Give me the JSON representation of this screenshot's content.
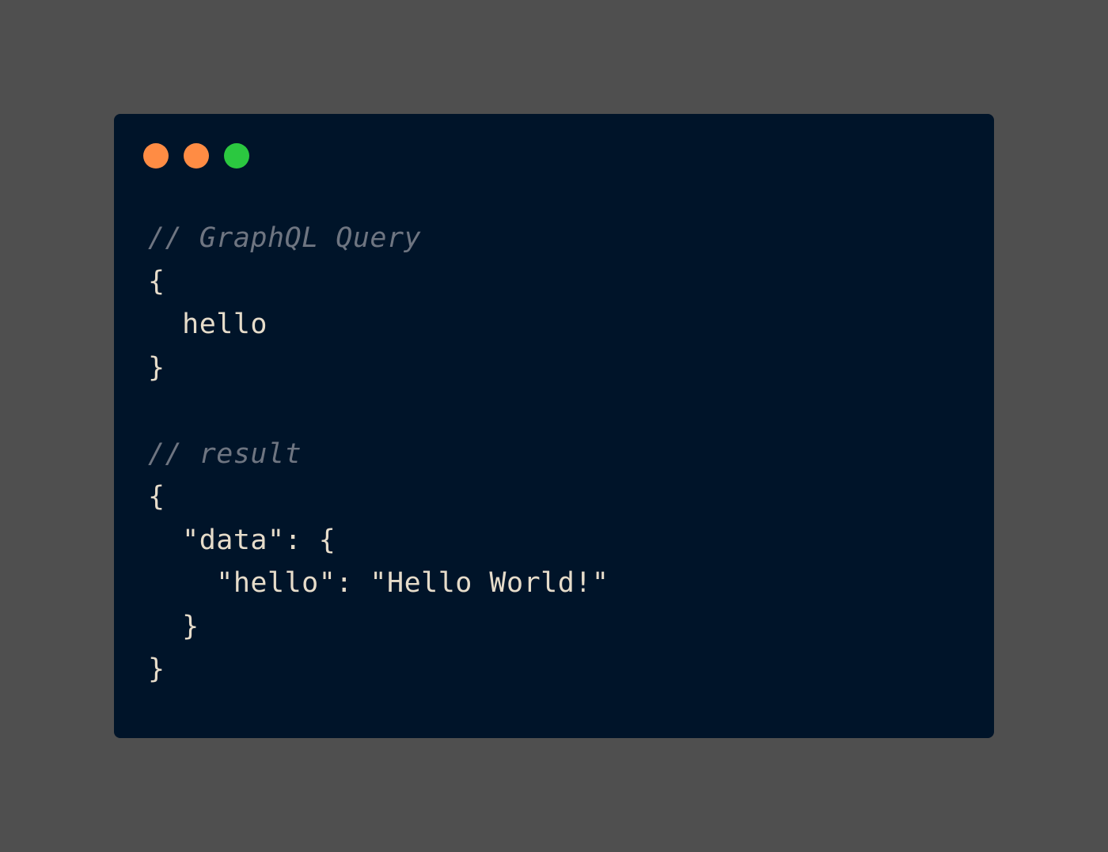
{
  "window": {
    "traffic_lights": [
      {
        "name": "close",
        "color": "#ff8c44"
      },
      {
        "name": "minimize",
        "color": "#ff8c44"
      },
      {
        "name": "maximize",
        "color": "#2bc840"
      }
    ]
  },
  "colors": {
    "page_background": "#4f4f4f",
    "editor_background": "#001429",
    "code_text": "#e6dcca",
    "comment_text": "#6e7581"
  },
  "code": {
    "lines": [
      {
        "text": "// GraphQL Query",
        "kind": "comment"
      },
      {
        "text": "{",
        "kind": "code"
      },
      {
        "text": "  hello",
        "kind": "code"
      },
      {
        "text": "}",
        "kind": "code"
      },
      {
        "text": "",
        "kind": "blank"
      },
      {
        "text": "// result",
        "kind": "comment"
      },
      {
        "text": "{",
        "kind": "code"
      },
      {
        "text": "  \"data\": {",
        "kind": "code"
      },
      {
        "text": "    \"hello\": \"Hello World!\"",
        "kind": "code"
      },
      {
        "text": "  }",
        "kind": "code"
      },
      {
        "text": "}",
        "kind": "code"
      }
    ]
  }
}
